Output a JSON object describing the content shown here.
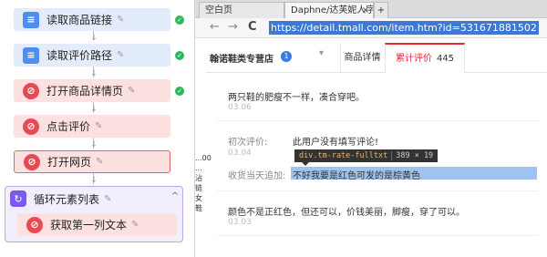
{
  "flow": {
    "steps": [
      {
        "label": "读取商品链接",
        "icon": "document-icon",
        "edit": "✎",
        "done": true
      },
      {
        "label": "读取评价路径",
        "icon": "document-icon",
        "edit": "✎",
        "done": true
      },
      {
        "label": "打开商品详情页",
        "icon": "compass-icon",
        "edit": "✎",
        "done": true
      },
      {
        "label": "点击评价",
        "icon": "compass-icon",
        "edit": "✎",
        "done": false
      },
      {
        "label": "打开网页",
        "icon": "compass-icon",
        "edit": "✎",
        "done": false
      }
    ],
    "loop": {
      "label": "循环元素列表",
      "icon": "loop-icon",
      "edit": "✎",
      "caret": "^",
      "child": {
        "label": "获取第一列文本",
        "icon": "compass-icon",
        "edit": "✎"
      }
    }
  },
  "browser": {
    "tabs": [
      {
        "label": "空白页"
      },
      {
        "label": "Daphne/达芙妮人字",
        "close": "×"
      },
      {
        "label": "+"
      }
    ],
    "nav": {
      "back": "←",
      "forward": "→",
      "reload": "C"
    },
    "url": "https://detail.tmall.com/item.htm?id=531671881502",
    "shop": {
      "name": "翰诺鞋类专营店",
      "badge": "1",
      "caret": "▾"
    },
    "page_tabs": {
      "detail": "商品详情",
      "reviews": "累计评价",
      "reviews_count": "445"
    },
    "reviews": [
      {
        "text": "两只鞋的肥瘦不一样，凑合穿吧。",
        "date": "03.06"
      },
      {
        "label": "初次评价:",
        "text": "此用户没有填写评论!",
        "date": "03.04",
        "append_label": "收货当天追加:",
        "append_text": "不好我要是红色可发的是棕黄色"
      },
      {
        "text": "颜色不是正红色，但还可以，价钱美丽，脚瘦，穿了可以。",
        "date": "03.03"
      }
    ],
    "tooltip": {
      "selector": "div.tm-rate-fulltxt",
      "size": "389 × 19"
    },
    "left_fragment": [
      "...00",
      "...",
      "沾链",
      "女鞋"
    ]
  },
  "colors": {
    "accent_red": "#e5253a",
    "url_highlight": "#3c78d8",
    "done_green": "#2eb85c",
    "loop_purple": "#7a5af0"
  }
}
